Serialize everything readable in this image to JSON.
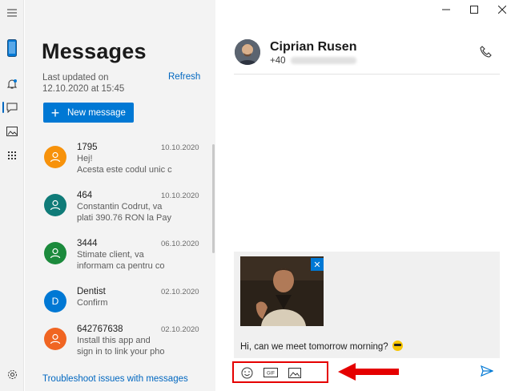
{
  "rail": {
    "items": [
      "menu-icon",
      "phone-icon",
      "notifications-icon",
      "messages-icon",
      "photos-icon",
      "apps-icon",
      "settings-icon"
    ],
    "active": "messages-icon"
  },
  "list": {
    "title": "Messages",
    "last_updated": "Last updated on 12.10.2020 at 15:45",
    "refresh_label": "Refresh",
    "new_message_label": "New message",
    "troubleshoot_label": "Troubleshoot issues with messages",
    "conversations": [
      {
        "name": "1795",
        "date": "10.10.2020",
        "preview": "Hej!\nAcesta este codul unic c",
        "avatar_color": "#f7920b",
        "avatar_letter": ""
      },
      {
        "name": "464",
        "date": "10.10.2020",
        "preview": "Constantin Codrut, va\nplati 390.76 RON la Pay",
        "avatar_color": "#0f7b78",
        "avatar_letter": ""
      },
      {
        "name": "3444",
        "date": "06.10.2020",
        "preview": "Stimate client, va\ninformam ca pentru co",
        "avatar_color": "#1b8a3c",
        "avatar_letter": ""
      },
      {
        "name": "Dentist",
        "date": "02.10.2020",
        "preview": "Confirm",
        "avatar_color": "#0078d4",
        "avatar_letter": "D"
      },
      {
        "name": "642767638",
        "date": "02.10.2020",
        "preview": "Install this app and\nsign in to link your pho",
        "avatar_color": "#f06522",
        "avatar_letter": ""
      }
    ]
  },
  "conversation": {
    "contact_name": "Ciprian Rusen",
    "contact_phone_prefix": "+40",
    "compose_text": "Hi, can we meet tomorrow morning?",
    "toolbar": [
      "emoji-icon",
      "gif-icon",
      "image-icon"
    ],
    "gif_label": "GIF"
  },
  "colors": {
    "accent": "#0078d4",
    "highlight": "#e50000"
  }
}
